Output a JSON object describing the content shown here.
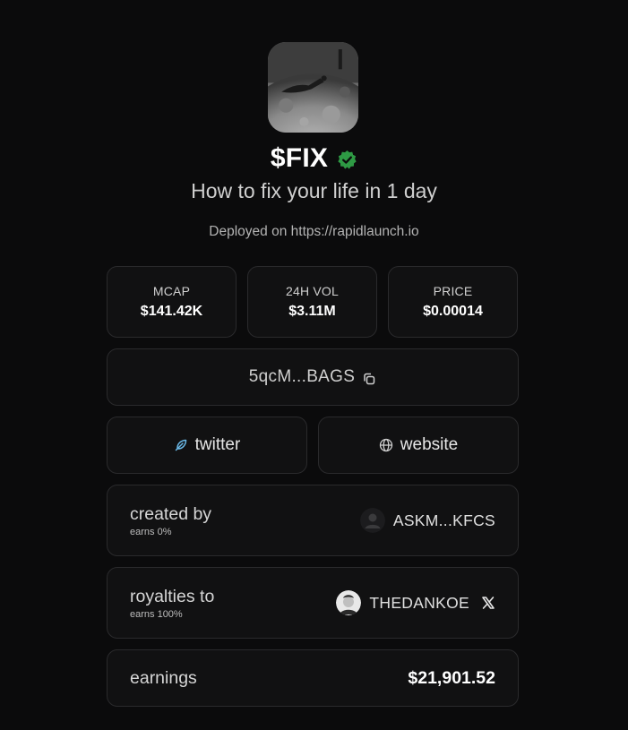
{
  "token": {
    "image_icon": "token-image",
    "ticker": "$FIX",
    "verified_icon": "verified-badge-icon",
    "verified_color": "#2e9a44",
    "subtitle": "How to fix your life in 1 day",
    "deployed_text": "Deployed on https://rapidlaunch.io"
  },
  "stats": [
    {
      "label": "MCAP",
      "value": "$141.42K"
    },
    {
      "label": "24H VOL",
      "value": "$3.11M"
    },
    {
      "label": "PRICE",
      "value": "$0.00014"
    }
  ],
  "address": {
    "text": "5qcM...BAGS",
    "copy_icon": "copy-icon"
  },
  "links": {
    "twitter_label": "twitter",
    "twitter_icon": "feather-icon",
    "twitter_icon_color": "#6ab8e6",
    "website_label": "website",
    "website_icon": "globe-icon"
  },
  "created_by": {
    "title": "created by",
    "sub": "earns 0%",
    "name": "ASKM...KFCS",
    "avatar_icon": "default-avatar-icon"
  },
  "royalties": {
    "title": "royalties to",
    "sub": "earns 100%",
    "name": "THEDANKOE",
    "avatar_icon": "user-avatar",
    "x_icon": "x-logo-icon"
  },
  "earnings": {
    "title": "earnings",
    "value": "$21,901.52"
  },
  "colors": {
    "background": "#0b0b0c",
    "card": "#111112",
    "card_border": "#2a2a2c"
  }
}
